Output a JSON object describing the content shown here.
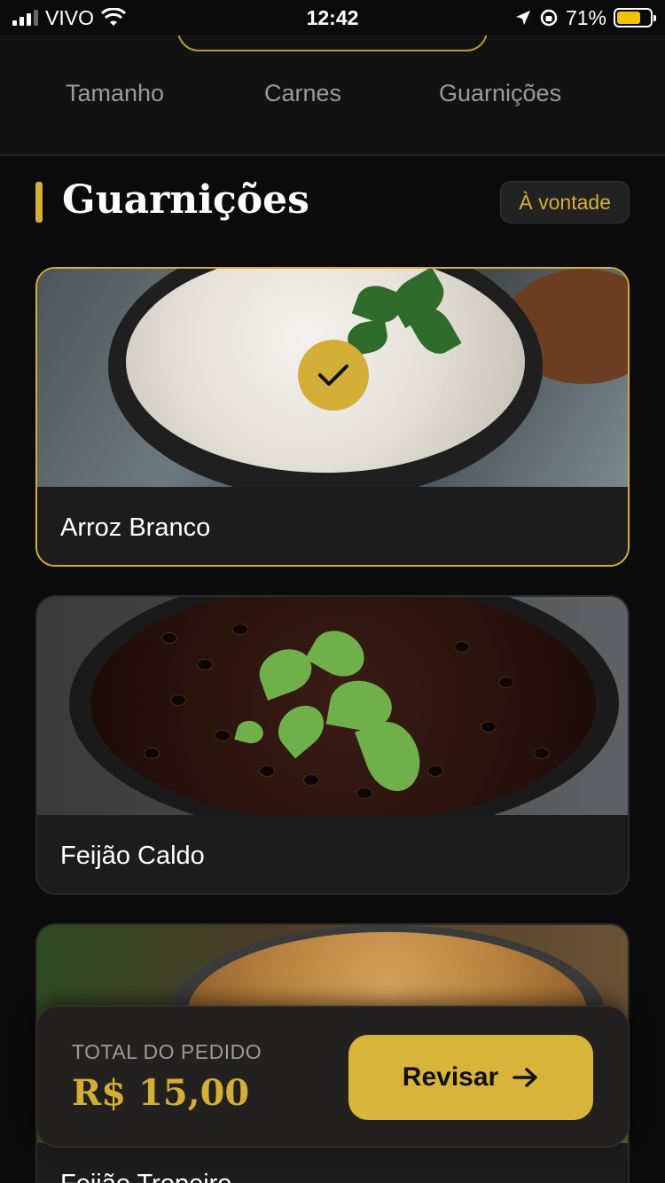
{
  "status_bar": {
    "carrier": "VIVO",
    "time": "12:42",
    "battery": "71%",
    "battery_level": 0.71
  },
  "tabs": [
    {
      "label": "Tamanho"
    },
    {
      "label": "Carnes"
    },
    {
      "label": "Guarnições"
    }
  ],
  "section": {
    "title": "Guarnições",
    "badge": "À vontade"
  },
  "items": [
    {
      "name": "Arroz Branco",
      "selected": true,
      "check_icon": "checkmark-icon"
    },
    {
      "name": "Feijão Caldo",
      "selected": false
    },
    {
      "name": "Feijão Tropeiro",
      "selected": false
    }
  ],
  "order": {
    "total_label": "TOTAL DO PEDIDO",
    "total_value": "R$ 15,00",
    "review_label": "Revisar"
  },
  "colors": {
    "accent": "#d4af37",
    "background": "#0b0b0b",
    "card": "#1c1c1c"
  }
}
